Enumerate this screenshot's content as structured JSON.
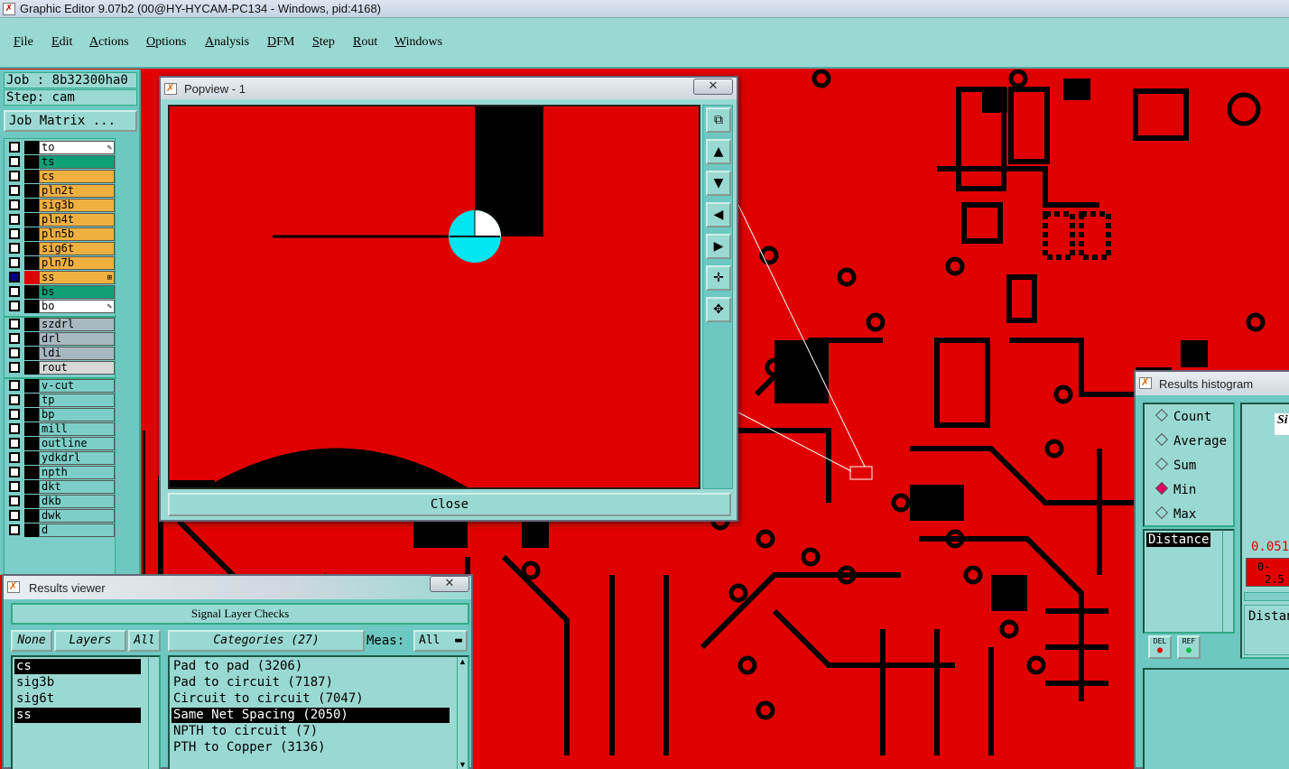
{
  "window": {
    "title": "Graphic Editor 9.07b2 (00@HY-HYCAM-PC134 - Windows, pid:4168)"
  },
  "menu": [
    "File",
    "Edit",
    "Actions",
    "Options",
    "Analysis",
    "DFM",
    "Step",
    "Rout",
    "Windows"
  ],
  "job": {
    "job_line": "Job : 8b32300ha0",
    "step_line": "Step: cam",
    "matrix_button": "Job Matrix ..."
  },
  "layers": [
    {
      "name": "to",
      "color": "#ffffff",
      "icon": "✎"
    },
    {
      "name": "ts",
      "color": "#10a078"
    },
    {
      "name": "cs",
      "color": "#f0b040"
    },
    {
      "name": "pln2t",
      "color": "#f0b040"
    },
    {
      "name": "sig3b",
      "color": "#f0b040"
    },
    {
      "name": "pln4t",
      "color": "#f0b040"
    },
    {
      "name": "pln5b",
      "color": "#f0b040"
    },
    {
      "name": "sig6t",
      "color": "#f0b040"
    },
    {
      "name": "pln7b",
      "color": "#f0b040"
    },
    {
      "name": "ss",
      "color": "#f0b040",
      "active": true,
      "icon": "⊞"
    },
    {
      "name": "bs",
      "color": "#10a078"
    },
    {
      "name": "bo",
      "color": "#ffffff",
      "icon": "✎"
    },
    {
      "name": "szdrl",
      "color": "#a8b8c0"
    },
    {
      "name": "drl",
      "color": "#a8b8c0"
    },
    {
      "name": "ldi",
      "color": "#a8b8c0"
    },
    {
      "name": "rout",
      "color": "#d8d8d8"
    },
    {
      "name": "v-cut",
      "color": "#7ccfc8"
    },
    {
      "name": "tp",
      "color": "#7ccfc8"
    },
    {
      "name": "bp",
      "color": "#7ccfc8"
    },
    {
      "name": "mill",
      "color": "#7ccfc8"
    },
    {
      "name": "outline",
      "color": "#7ccfc8"
    },
    {
      "name": "ydkdrl",
      "color": "#7ccfc8"
    },
    {
      "name": "npth",
      "color": "#7ccfc8"
    },
    {
      "name": "dkt",
      "color": "#7ccfc8"
    },
    {
      "name": "dkb",
      "color": "#7ccfc8"
    },
    {
      "name": "dwk",
      "color": "#7ccfc8"
    },
    {
      "name": "d",
      "color": "#7ccfc8"
    }
  ],
  "popview": {
    "title": "Popview - 1",
    "close_label": "Close"
  },
  "results_viewer": {
    "title": "Results viewer",
    "section": "Signal Layer Checks",
    "none_btn": "None",
    "layers_btn": "Layers",
    "all_btn": "All",
    "categories_btn": "Categories (27)",
    "meas_label": "Meas:",
    "meas_value": "All",
    "layer_items": [
      "cs",
      "sig3b",
      "sig6t",
      "ss"
    ],
    "category_items": [
      "Pad to pad (3206)",
      "Pad to circuit (7187)",
      "Circuit to circuit (7047)",
      "Same Net Spacing (2050)",
      "NPTH to circuit (7)",
      "PTH to Copper (3136)"
    ]
  },
  "histogram": {
    "title": "Results histogram",
    "options": [
      "Count",
      "Average",
      "Sum",
      "Min",
      "Max"
    ],
    "selected": "Min",
    "field": "Distance",
    "del_btn": "DEL",
    "ref_btn": "REF",
    "value": "0.051",
    "range_a": "0-",
    "range_b": "2.5",
    "right_label": "Distan",
    "side_label": "Si"
  },
  "colors": {
    "board": "#e00000",
    "ui": "#9ad9d3",
    "ui_dark": "#6cc8c0",
    "accent": "#00e5f0"
  }
}
